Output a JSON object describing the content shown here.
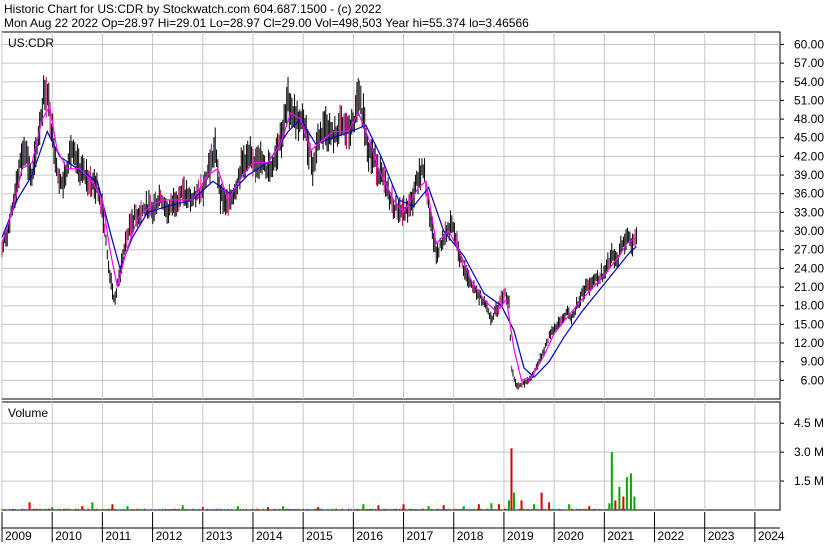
{
  "header": {
    "line1": "Historic Chart for US:CDR by Stockwatch.com 604.687.1500 - (c) 2022",
    "line2": "Mon Aug 22 2022   Op=28.97   Hi=29.01   Lo=28.97   Cl=29.00   Vol=498,503   Year hi=55.374   lo=3.46566"
  },
  "chart_data": [
    {
      "type": "line",
      "title": "US:CDR",
      "ylim": [
        3.0,
        62.0
      ],
      "y_ticks": [
        6,
        9,
        12,
        15,
        18,
        21,
        24,
        27,
        30,
        33,
        36,
        39,
        42,
        45,
        48,
        51,
        54,
        57,
        60
      ],
      "y_tick_labels": [
        "6.00",
        "9.00",
        "12.00",
        "15.00",
        "18.00",
        "21.00",
        "24.00",
        "27.00",
        "30.00",
        "33.00",
        "36.00",
        "39.00",
        "42.00",
        "45.00",
        "48.00",
        "51.00",
        "54.00",
        "57.00",
        "60.00"
      ],
      "x_range": [
        2009.0,
        2024.5
      ],
      "x_ticks": [
        2009,
        2010,
        2011,
        2012,
        2013,
        2014,
        2015,
        2016,
        2017,
        2018,
        2019,
        2020,
        2021,
        2022,
        2023,
        2024
      ],
      "x_tick_labels": [
        "2009",
        "2010",
        "2011",
        "2012",
        "2013",
        "2014",
        "2015",
        "2016",
        "2017",
        "2018",
        "2019",
        "2020",
        "2021",
        "2022",
        "2023",
        "2024"
      ],
      "grid": true,
      "colors": {
        "price": "#000000",
        "accent": "#cc0077",
        "ma_short": "#ff00ff",
        "ma_long": "#0000cc",
        "grid": "#c8c8c8"
      },
      "price_points": [
        [
          2009.0,
          27
        ],
        [
          2009.15,
          31
        ],
        [
          2009.3,
          38
        ],
        [
          2009.45,
          44
        ],
        [
          2009.6,
          38
        ],
        [
          2009.75,
          47
        ],
        [
          2009.85,
          53
        ],
        [
          2009.92,
          51
        ],
        [
          2010.0,
          46
        ],
        [
          2010.1,
          40
        ],
        [
          2010.2,
          37
        ],
        [
          2010.35,
          43
        ],
        [
          2010.55,
          40
        ],
        [
          2010.75,
          38
        ],
        [
          2010.9,
          37
        ],
        [
          2011.0,
          34
        ],
        [
          2011.1,
          26
        ],
        [
          2011.2,
          20
        ],
        [
          2011.25,
          19
        ],
        [
          2011.35,
          23
        ],
        [
          2011.45,
          28
        ],
        [
          2011.6,
          32
        ],
        [
          2011.75,
          33
        ],
        [
          2011.9,
          34
        ],
        [
          2012.0,
          33
        ],
        [
          2012.15,
          36
        ],
        [
          2012.3,
          33
        ],
        [
          2012.45,
          35
        ],
        [
          2012.6,
          36
        ],
        [
          2012.8,
          35
        ],
        [
          2013.0,
          37
        ],
        [
          2013.15,
          41
        ],
        [
          2013.25,
          43
        ],
        [
          2013.35,
          36
        ],
        [
          2013.5,
          34
        ],
        [
          2013.65,
          37
        ],
        [
          2013.8,
          41
        ],
        [
          2013.95,
          42
        ],
        [
          2014.0,
          40
        ],
        [
          2014.1,
          42
        ],
        [
          2014.25,
          40
        ],
        [
          2014.4,
          41
        ],
        [
          2014.5,
          44
        ],
        [
          2014.6,
          46
        ],
        [
          2014.7,
          51
        ],
        [
          2014.8,
          49
        ],
        [
          2014.95,
          47
        ],
        [
          2015.0,
          48
        ],
        [
          2015.1,
          44
        ],
        [
          2015.2,
          40
        ],
        [
          2015.3,
          45
        ],
        [
          2015.45,
          47
        ],
        [
          2015.6,
          45
        ],
        [
          2015.75,
          47
        ],
        [
          2015.9,
          46
        ],
        [
          2016.0,
          47
        ],
        [
          2016.1,
          51
        ],
        [
          2016.2,
          49
        ],
        [
          2016.3,
          43
        ],
        [
          2016.45,
          41
        ],
        [
          2016.6,
          38
        ],
        [
          2016.8,
          34
        ],
        [
          2017.0,
          33
        ],
        [
          2017.15,
          34
        ],
        [
          2017.3,
          39
        ],
        [
          2017.4,
          40
        ],
        [
          2017.55,
          31
        ],
        [
          2017.65,
          26
        ],
        [
          2017.8,
          29
        ],
        [
          2017.95,
          31
        ],
        [
          2018.0,
          30
        ],
        [
          2018.15,
          25
        ],
        [
          2018.3,
          22
        ],
        [
          2018.45,
          20
        ],
        [
          2018.6,
          19
        ],
        [
          2018.75,
          16
        ],
        [
          2018.9,
          18
        ],
        [
          2019.0,
          20
        ],
        [
          2019.1,
          19
        ],
        [
          2019.15,
          8
        ],
        [
          2019.25,
          5
        ],
        [
          2019.4,
          5.5
        ],
        [
          2019.55,
          6.5
        ],
        [
          2019.7,
          9
        ],
        [
          2019.85,
          12
        ],
        [
          2019.95,
          14
        ],
        [
          2020.1,
          15
        ],
        [
          2020.25,
          17
        ],
        [
          2020.35,
          16
        ],
        [
          2020.55,
          20
        ],
        [
          2020.75,
          22
        ],
        [
          2020.95,
          23
        ],
        [
          2021.0,
          23
        ],
        [
          2021.15,
          26
        ],
        [
          2021.25,
          25
        ],
        [
          2021.35,
          28
        ],
        [
          2021.45,
          29
        ],
        [
          2021.55,
          28
        ],
        [
          2021.64,
          29
        ]
      ],
      "ma_short_points": [
        [
          2009.0,
          28
        ],
        [
          2009.2,
          33
        ],
        [
          2009.4,
          40
        ],
        [
          2009.6,
          41
        ],
        [
          2009.8,
          48
        ],
        [
          2009.95,
          50
        ],
        [
          2010.1,
          43
        ],
        [
          2010.3,
          40
        ],
        [
          2010.55,
          40
        ],
        [
          2010.8,
          38
        ],
        [
          2011.0,
          35
        ],
        [
          2011.15,
          27
        ],
        [
          2011.3,
          21
        ],
        [
          2011.45,
          26
        ],
        [
          2011.7,
          32
        ],
        [
          2011.95,
          34
        ],
        [
          2012.2,
          35
        ],
        [
          2012.5,
          35
        ],
        [
          2012.8,
          35
        ],
        [
          2013.1,
          39
        ],
        [
          2013.3,
          40
        ],
        [
          2013.5,
          35
        ],
        [
          2013.8,
          39
        ],
        [
          2014.0,
          41
        ],
        [
          2014.3,
          41
        ],
        [
          2014.55,
          44
        ],
        [
          2014.75,
          49
        ],
        [
          2014.95,
          48
        ],
        [
          2015.15,
          43
        ],
        [
          2015.3,
          44
        ],
        [
          2015.6,
          46
        ],
        [
          2015.9,
          46
        ],
        [
          2016.1,
          49
        ],
        [
          2016.3,
          45
        ],
        [
          2016.5,
          40
        ],
        [
          2016.8,
          35
        ],
        [
          2017.0,
          33
        ],
        [
          2017.3,
          37
        ],
        [
          2017.45,
          38
        ],
        [
          2017.65,
          28
        ],
        [
          2017.9,
          30
        ],
        [
          2018.1,
          27
        ],
        [
          2018.35,
          22
        ],
        [
          2018.6,
          19
        ],
        [
          2018.85,
          17
        ],
        [
          2019.05,
          19
        ],
        [
          2019.2,
          11
        ],
        [
          2019.35,
          6
        ],
        [
          2019.55,
          6.5
        ],
        [
          2019.8,
          10
        ],
        [
          2020.0,
          13.5
        ],
        [
          2020.25,
          16
        ],
        [
          2020.55,
          19
        ],
        [
          2020.9,
          22
        ],
        [
          2021.1,
          24
        ],
        [
          2021.3,
          26
        ],
        [
          2021.45,
          28
        ],
        [
          2021.64,
          29
        ]
      ],
      "ma_long_points": [
        [
          2009.0,
          29
        ],
        [
          2009.3,
          35
        ],
        [
          2009.6,
          39
        ],
        [
          2009.9,
          46
        ],
        [
          2010.15,
          42
        ],
        [
          2010.5,
          40
        ],
        [
          2010.9,
          38
        ],
        [
          2011.15,
          30
        ],
        [
          2011.35,
          24
        ],
        [
          2011.6,
          29
        ],
        [
          2011.9,
          33
        ],
        [
          2012.3,
          34
        ],
        [
          2012.8,
          35
        ],
        [
          2013.2,
          38
        ],
        [
          2013.55,
          36
        ],
        [
          2013.9,
          39
        ],
        [
          2014.3,
          41
        ],
        [
          2014.7,
          46
        ],
        [
          2014.95,
          48
        ],
        [
          2015.25,
          44
        ],
        [
          2015.6,
          45
        ],
        [
          2015.95,
          46
        ],
        [
          2016.25,
          47
        ],
        [
          2016.55,
          42
        ],
        [
          2016.9,
          35
        ],
        [
          2017.2,
          34
        ],
        [
          2017.5,
          37
        ],
        [
          2017.8,
          30
        ],
        [
          2018.2,
          26
        ],
        [
          2018.6,
          20
        ],
        [
          2018.95,
          18
        ],
        [
          2019.2,
          14
        ],
        [
          2019.4,
          8
        ],
        [
          2019.6,
          6.5
        ],
        [
          2019.9,
          9
        ],
        [
          2020.2,
          13
        ],
        [
          2020.55,
          17
        ],
        [
          2020.95,
          21
        ],
        [
          2021.25,
          24
        ],
        [
          2021.5,
          26.5
        ],
        [
          2021.64,
          27.5
        ]
      ]
    },
    {
      "type": "bar",
      "title": "Volume",
      "ylim": [
        0,
        5.6
      ],
      "y_ticks": [
        1.5,
        3.0,
        4.5
      ],
      "y_tick_labels": [
        "1.5 M",
        "3.0 M",
        "4.5 M"
      ],
      "x_range": [
        2009.0,
        2024.5
      ],
      "base_volume": 0.05,
      "colors": {
        "up": "#00aa00",
        "down": "#dd0000",
        "base": "#444444"
      },
      "spikes": [
        [
          2009.55,
          0.4,
          "red"
        ],
        [
          2010.0,
          0.15,
          "green"
        ],
        [
          2010.6,
          0.2,
          "red"
        ],
        [
          2010.8,
          0.4,
          "green"
        ],
        [
          2011.2,
          0.3,
          "red"
        ],
        [
          2011.5,
          0.2,
          "green"
        ],
        [
          2012.6,
          0.25,
          "green"
        ],
        [
          2013.0,
          0.15,
          "red"
        ],
        [
          2013.7,
          0.2,
          "green"
        ],
        [
          2014.3,
          0.15,
          "red"
        ],
        [
          2014.6,
          0.2,
          "green"
        ],
        [
          2015.3,
          0.15,
          "red"
        ],
        [
          2016.2,
          0.3,
          "green"
        ],
        [
          2016.5,
          0.25,
          "red"
        ],
        [
          2017.0,
          0.3,
          "red"
        ],
        [
          2017.5,
          0.2,
          "green"
        ],
        [
          2017.8,
          0.25,
          "red"
        ],
        [
          2018.2,
          0.2,
          "green"
        ],
        [
          2018.5,
          0.3,
          "red"
        ],
        [
          2018.75,
          0.35,
          "green"
        ],
        [
          2018.9,
          0.3,
          "red"
        ],
        [
          2019.1,
          0.5,
          "green"
        ],
        [
          2019.15,
          3.2,
          "red"
        ],
        [
          2019.2,
          0.9,
          "green"
        ],
        [
          2019.35,
          0.5,
          "red"
        ],
        [
          2019.6,
          0.3,
          "green"
        ],
        [
          2019.75,
          0.9,
          "red"
        ],
        [
          2019.9,
          0.4,
          "red"
        ],
        [
          2020.3,
          0.3,
          "green"
        ],
        [
          2020.7,
          0.2,
          "red"
        ],
        [
          2021.1,
          0.35,
          "green"
        ],
        [
          2021.15,
          3.0,
          "green"
        ],
        [
          2021.22,
          0.5,
          "red"
        ],
        [
          2021.3,
          1.2,
          "green"
        ],
        [
          2021.38,
          0.7,
          "red"
        ],
        [
          2021.45,
          1.7,
          "green"
        ],
        [
          2021.53,
          1.9,
          "green"
        ],
        [
          2021.6,
          0.7,
          "green"
        ]
      ]
    }
  ]
}
